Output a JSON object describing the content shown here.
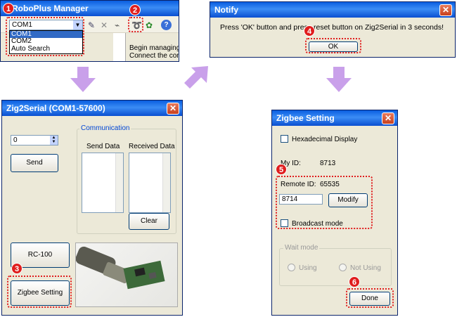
{
  "badges": [
    "1",
    "2",
    "3",
    "4",
    "5",
    "6"
  ],
  "robo": {
    "title": "RoboPlus Manager",
    "port_value": "COM1",
    "port_options": [
      "COM1",
      "COM2",
      "Auto Search"
    ],
    "side_text_1": "Begin managing c",
    "side_text_2": "Connect the contr"
  },
  "notify": {
    "title": "Notify",
    "message": "Press 'OK' button and press reset button on Zig2Serial in 3 seconds!",
    "ok_label": "OK"
  },
  "zig2serial": {
    "title": "Zig2Serial (COM1-57600)",
    "value_field": "0",
    "send_label": "Send",
    "comm_group": "Communication",
    "send_data_label": "Send Data",
    "received_data_label": "Received Data",
    "clear_label": "Clear",
    "rc100_label": "RC-100",
    "zigbee_setting_label": "Zigbee Setting"
  },
  "zigbee": {
    "title": "Zigbee Setting",
    "hex_label": "Hexadecimal Display",
    "my_id_label": "My ID:",
    "my_id_value": "8713",
    "remote_id_label": "Remote ID:",
    "remote_id_value": "65535",
    "remote_input": "8714",
    "modify_label": "Modify",
    "broadcast_label": "Broadcast mode",
    "wait_mode_label": "Wait mode",
    "using_label": "Using",
    "not_using_label": "Not Using",
    "done_label": "Done"
  },
  "colors": {
    "accent_red": "#e01e1e",
    "arrow": "#c9a0ea",
    "title_blue": "#0a5ee0"
  }
}
